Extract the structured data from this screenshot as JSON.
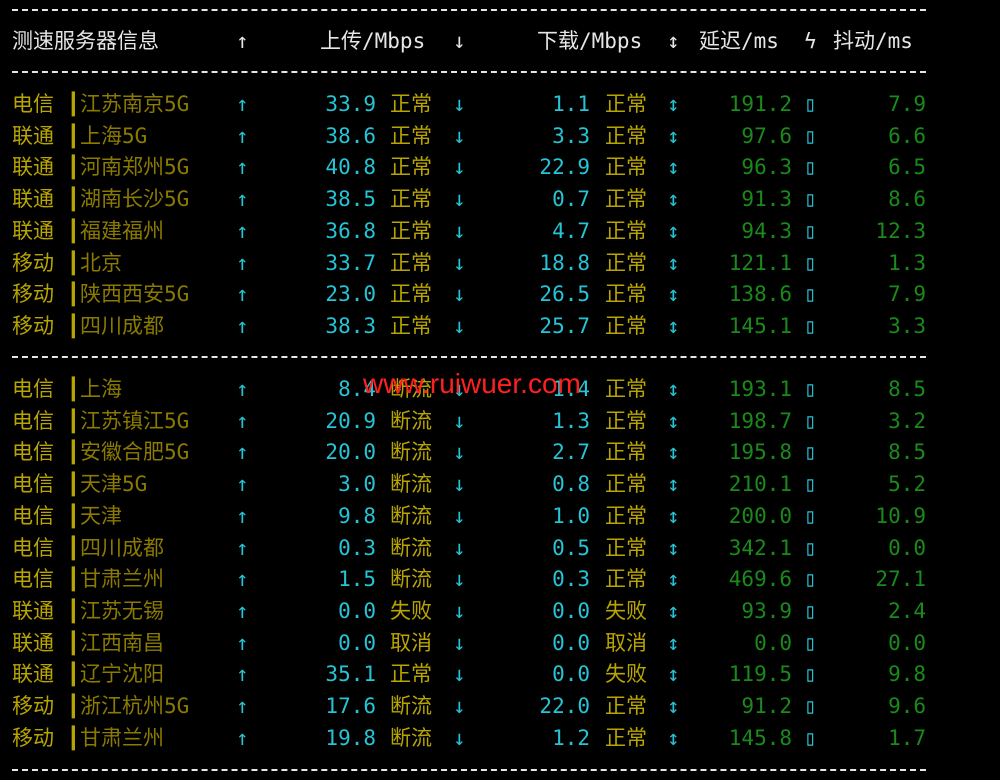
{
  "header": {
    "server": "测速服务器信息",
    "up_arrow": "↑",
    "upload": "上传/Mbps",
    "down_arrow": "↓",
    "download": "下载/Mbps",
    "updown_arrow": "↕",
    "latency": "延迟/ms",
    "lightning": "ϟ",
    "jitter": "抖动/ms"
  },
  "separator": "┃",
  "symbols": {
    "up": "↑",
    "down": "↓",
    "updown": "↕",
    "box": "▯"
  },
  "groups": [
    [
      {
        "isp": "电信",
        "city": "江苏南京5G",
        "up": "33.9",
        "up_status": "正常",
        "down": "1.1",
        "down_status": "正常",
        "latency": "191.2",
        "jitter": "7.9"
      },
      {
        "isp": "联通",
        "city": "上海5G",
        "up": "38.6",
        "up_status": "正常",
        "down": "3.3",
        "down_status": "正常",
        "latency": "97.6",
        "jitter": "6.6"
      },
      {
        "isp": "联通",
        "city": "河南郑州5G",
        "up": "40.8",
        "up_status": "正常",
        "down": "22.9",
        "down_status": "正常",
        "latency": "96.3",
        "jitter": "6.5"
      },
      {
        "isp": "联通",
        "city": "湖南长沙5G",
        "up": "38.5",
        "up_status": "正常",
        "down": "0.7",
        "down_status": "正常",
        "latency": "91.3",
        "jitter": "8.6"
      },
      {
        "isp": "联通",
        "city": "福建福州",
        "up": "36.8",
        "up_status": "正常",
        "down": "4.7",
        "down_status": "正常",
        "latency": "94.3",
        "jitter": "12.3"
      },
      {
        "isp": "移动",
        "city": "北京",
        "up": "33.7",
        "up_status": "正常",
        "down": "18.8",
        "down_status": "正常",
        "latency": "121.1",
        "jitter": "1.3"
      },
      {
        "isp": "移动",
        "city": "陕西西安5G",
        "up": "23.0",
        "up_status": "正常",
        "down": "26.5",
        "down_status": "正常",
        "latency": "138.6",
        "jitter": "7.9"
      },
      {
        "isp": "移动",
        "city": "四川成都",
        "up": "38.3",
        "up_status": "正常",
        "down": "25.7",
        "down_status": "正常",
        "latency": "145.1",
        "jitter": "3.3"
      }
    ],
    [
      {
        "isp": "电信",
        "city": "上海",
        "up": "8.4",
        "up_status": "断流",
        "down": "1.4",
        "down_status": "正常",
        "latency": "193.1",
        "jitter": "8.5"
      },
      {
        "isp": "电信",
        "city": "江苏镇江5G",
        "up": "20.9",
        "up_status": "断流",
        "down": "1.3",
        "down_status": "正常",
        "latency": "198.7",
        "jitter": "3.2"
      },
      {
        "isp": "电信",
        "city": "安徽合肥5G",
        "up": "20.0",
        "up_status": "断流",
        "down": "2.7",
        "down_status": "正常",
        "latency": "195.8",
        "jitter": "8.5"
      },
      {
        "isp": "电信",
        "city": "天津5G",
        "up": "3.0",
        "up_status": "断流",
        "down": "0.8",
        "down_status": "正常",
        "latency": "210.1",
        "jitter": "5.2"
      },
      {
        "isp": "电信",
        "city": "天津",
        "up": "9.8",
        "up_status": "断流",
        "down": "1.0",
        "down_status": "正常",
        "latency": "200.0",
        "jitter": "10.9"
      },
      {
        "isp": "电信",
        "city": "四川成都",
        "up": "0.3",
        "up_status": "断流",
        "down": "0.5",
        "down_status": "正常",
        "latency": "342.1",
        "jitter": "0.0"
      },
      {
        "isp": "电信",
        "city": "甘肃兰州",
        "up": "1.5",
        "up_status": "断流",
        "down": "0.3",
        "down_status": "正常",
        "latency": "469.6",
        "jitter": "27.1"
      },
      {
        "isp": "联通",
        "city": "江苏无锡",
        "up": "0.0",
        "up_status": "失败",
        "down": "0.0",
        "down_status": "失败",
        "latency": "93.9",
        "jitter": "2.4"
      },
      {
        "isp": "联通",
        "city": "江西南昌",
        "up": "0.0",
        "up_status": "取消",
        "down": "0.0",
        "down_status": "取消",
        "latency": "0.0",
        "jitter": "0.0"
      },
      {
        "isp": "联通",
        "city": "辽宁沈阳",
        "up": "35.1",
        "up_status": "正常",
        "down": "0.0",
        "down_status": "失败",
        "latency": "119.5",
        "jitter": "9.8"
      },
      {
        "isp": "移动",
        "city": "浙江杭州5G",
        "up": "17.6",
        "up_status": "断流",
        "down": "22.0",
        "down_status": "正常",
        "latency": "91.2",
        "jitter": "9.6"
      },
      {
        "isp": "移动",
        "city": "甘肃兰州",
        "up": "19.8",
        "up_status": "断流",
        "down": "1.2",
        "down_status": "正常",
        "latency": "145.8",
        "jitter": "1.7"
      }
    ]
  ],
  "watermark": "www.ruiwuer.com"
}
